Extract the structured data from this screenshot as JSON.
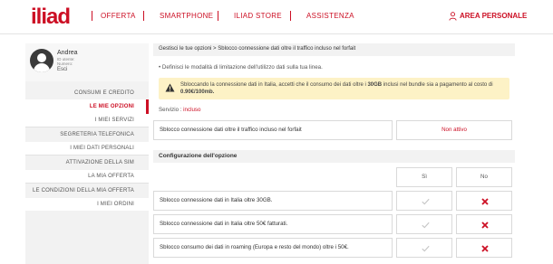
{
  "header": {
    "logo": "iliad",
    "nav": [
      "OFFERTA",
      "SMARTPHONE",
      "ILIAD STORE",
      "ASSISTENZA"
    ],
    "area_personale": "AREA PERSONALE"
  },
  "sidebar": {
    "profile": {
      "name": "Andrea",
      "id_label": "ID utente:",
      "number_label": "Numero:",
      "exit": "Esci"
    },
    "items": [
      {
        "label": "CONSUMI E CREDITO",
        "active": false
      },
      {
        "label": "LE MIE OPZIONI",
        "active": true
      },
      {
        "label": "I MIEI SERVIZI",
        "active": false
      },
      {
        "label": "SEGRETERIA TELEFONICA",
        "active": false
      },
      {
        "label": "I MIEI DATI PERSONALI",
        "active": false
      },
      {
        "label": "ATTIVAZIONE DELLA SIM",
        "active": false
      },
      {
        "label": "LA MIA OFFERTA",
        "active": false
      },
      {
        "label": "LE CONDIZIONI DELLA MIA OFFERTA",
        "active": false
      },
      {
        "label": "I MIEI ORDINI",
        "active": false
      }
    ]
  },
  "breadcrumb": {
    "parent": "Gestisci le tue opzioni",
    "separator": ">",
    "current": "Sblocco connessione dati oltre il traffico incluso nel forfait"
  },
  "description": "Definisci le modalità di limitazione dell'utilizzo dati sulla tua linea.",
  "alert": {
    "text_before": "Sbloccando la connessione dati in Italia, accetti che il consumo dei dati oltre i ",
    "highlight1": "30GB",
    "text_middle": " inclusi nel bundle sia a pagamento al costo di ",
    "highlight2": "0.90€/100mb."
  },
  "servizio": {
    "label": "Servizio : ",
    "value": "incluso"
  },
  "option_status": {
    "label": "Sblocco connessione dati oltre il traffico incluso nel forfait",
    "status": "Non attivo"
  },
  "configuration": {
    "title": "Configurazione dell'opzione",
    "columns": [
      "Sì",
      "No"
    ],
    "rows": [
      {
        "label": "Sblocco connessione dati in Italia oltre 30GB.",
        "si": "check",
        "no": "cross"
      },
      {
        "label": "Sblocco connessione dati in Italia oltre 50€ fatturati.",
        "si": "check",
        "no": "cross"
      },
      {
        "label": "Sblocco consumo dei dati in roaming (Europa e resto del mondo) oltre i 50€.",
        "si": "check",
        "no": "cross"
      }
    ]
  },
  "colors": {
    "brand": "#cc0f24",
    "alert_bg": "#fdf2c6",
    "panel_bg": "#f2f2f2"
  }
}
